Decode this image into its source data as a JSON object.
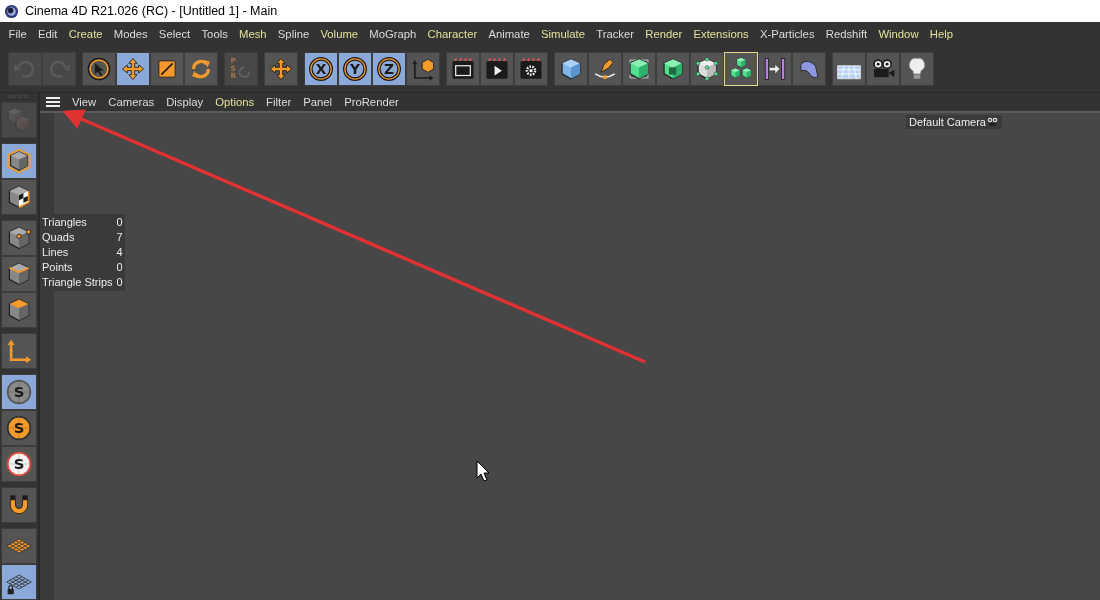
{
  "window": {
    "title": "Cinema 4D R21.026 (RC) - [Untitled 1] - Main"
  },
  "menu_bar": [
    {
      "label": "File",
      "color": "#dcdcdc"
    },
    {
      "label": "Edit",
      "color": "#dcdcdc"
    },
    {
      "label": "Create",
      "color": "#e3e09a"
    },
    {
      "label": "Modes",
      "color": "#dcdcdc"
    },
    {
      "label": "Select",
      "color": "#dcdcdc"
    },
    {
      "label": "Tools",
      "color": "#dcdcdc"
    },
    {
      "label": "Mesh",
      "color": "#e3e09a"
    },
    {
      "label": "Spline",
      "color": "#dcdcdc"
    },
    {
      "label": "Volume",
      "color": "#e3e09a"
    },
    {
      "label": "MoGraph",
      "color": "#dcdcdc"
    },
    {
      "label": "Character",
      "color": "#e3e09a"
    },
    {
      "label": "Animate",
      "color": "#dcdcdc"
    },
    {
      "label": "Simulate",
      "color": "#e3e09a"
    },
    {
      "label": "Tracker",
      "color": "#dcdcdc"
    },
    {
      "label": "Render",
      "color": "#e3e09a"
    },
    {
      "label": "Extensions",
      "color": "#e3e09a"
    },
    {
      "label": "X-Particles",
      "color": "#dcdcdc"
    },
    {
      "label": "Redshift",
      "color": "#dcdcdc"
    },
    {
      "label": "Window",
      "color": "#e3e09a"
    },
    {
      "label": "Help",
      "color": "#e3e09a"
    }
  ],
  "toolbar": [
    {
      "tools": [
        {
          "kind": "undo",
          "selected": false,
          "disabled": true
        },
        {
          "kind": "redo",
          "selected": false,
          "disabled": true
        }
      ]
    },
    {
      "tools": [
        {
          "kind": "select",
          "selected": false,
          "disabled": false
        },
        {
          "kind": "move",
          "selected": true,
          "disabled": false
        },
        {
          "kind": "scale",
          "selected": false,
          "disabled": false
        },
        {
          "kind": "rotate",
          "selected": false,
          "disabled": false
        }
      ]
    },
    {
      "tools": [
        {
          "kind": "psr",
          "label": "PSR",
          "selected": false,
          "disabled": true
        }
      ]
    },
    {
      "tools": [
        {
          "kind": "axis-move",
          "selected": false,
          "disabled": false
        }
      ]
    },
    {
      "tools": [
        {
          "kind": "letter",
          "label": "X",
          "selected": true,
          "disabled": false
        },
        {
          "kind": "letter",
          "label": "Y",
          "selected": true,
          "disabled": false
        },
        {
          "kind": "letter",
          "label": "Z",
          "selected": true,
          "disabled": false
        },
        {
          "kind": "coords",
          "selected": false,
          "disabled": false
        }
      ]
    },
    {
      "tools": [
        {
          "kind": "render-view",
          "selected": false,
          "disabled": false
        },
        {
          "kind": "render",
          "selected": false,
          "disabled": false
        },
        {
          "kind": "render-settings",
          "selected": false,
          "disabled": false
        }
      ]
    },
    {
      "tools": [
        {
          "kind": "cube",
          "selected": false,
          "disabled": false
        },
        {
          "kind": "pen",
          "selected": false,
          "disabled": false
        },
        {
          "kind": "subdiv",
          "selected": false,
          "disabled": false
        },
        {
          "kind": "frame-cube",
          "selected": false,
          "disabled": false
        },
        {
          "kind": "points-cube",
          "selected": false,
          "disabled": false
        },
        {
          "kind": "cubes",
          "selected": false,
          "disabled": false,
          "focused": true
        },
        {
          "kind": "bars-arrow",
          "selected": false,
          "disabled": false
        },
        {
          "kind": "bend",
          "selected": false,
          "disabled": false
        }
      ]
    },
    {
      "tools": [
        {
          "kind": "floor",
          "selected": false,
          "disabled": false
        },
        {
          "kind": "camera",
          "selected": false,
          "disabled": false
        },
        {
          "kind": "bulb",
          "selected": false,
          "disabled": false
        }
      ]
    }
  ],
  "sidebar": [
    {
      "tools": [
        {
          "kind": "gray-cubes",
          "selected": false,
          "disabled": true
        }
      ]
    },
    {
      "tools": [
        {
          "kind": "model",
          "selected": true,
          "disabled": false
        },
        {
          "kind": "texture",
          "selected": false,
          "disabled": false
        }
      ]
    },
    {
      "tools": [
        {
          "kind": "points",
          "selected": false,
          "disabled": false
        },
        {
          "kind": "edges",
          "selected": false,
          "disabled": false
        },
        {
          "kind": "polygons",
          "selected": false,
          "disabled": false
        }
      ]
    },
    {
      "tools": [
        {
          "kind": "axis",
          "selected": false,
          "disabled": false
        }
      ]
    },
    {
      "tools": [
        {
          "kind": "snap-gray",
          "label": "S",
          "selected": true,
          "disabled": false
        },
        {
          "kind": "snap-orange",
          "label": "S",
          "selected": false,
          "disabled": false
        },
        {
          "kind": "snap-white",
          "label": "S",
          "selected": false,
          "disabled": false
        }
      ]
    },
    {
      "tools": [
        {
          "kind": "magnet",
          "selected": false,
          "disabled": false
        }
      ]
    },
    {
      "tools": [
        {
          "kind": "plane",
          "selected": false,
          "disabled": false
        },
        {
          "kind": "grid",
          "selected": true,
          "disabled": false
        }
      ]
    }
  ],
  "viewport": {
    "menu": [
      {
        "label": "View",
        "color": "#dcdcdc"
      },
      {
        "label": "Cameras",
        "color": "#dcdcdc"
      },
      {
        "label": "Display",
        "color": "#dcdcdc"
      },
      {
        "label": "Options",
        "color": "#e3e09a"
      },
      {
        "label": "Filter",
        "color": "#dcdcdc"
      },
      {
        "label": "Panel",
        "color": "#dcdcdc"
      },
      {
        "label": "ProRender",
        "color": "#dcdcdc"
      }
    ],
    "camera_label": "Default Camera",
    "stats": [
      {
        "label": "Triangles",
        "value": "0"
      },
      {
        "label": "Quads",
        "value": "7"
      },
      {
        "label": "Lines",
        "value": "4"
      },
      {
        "label": "Points",
        "value": "0"
      },
      {
        "label": "Triangle Strips",
        "value": "0"
      }
    ]
  }
}
